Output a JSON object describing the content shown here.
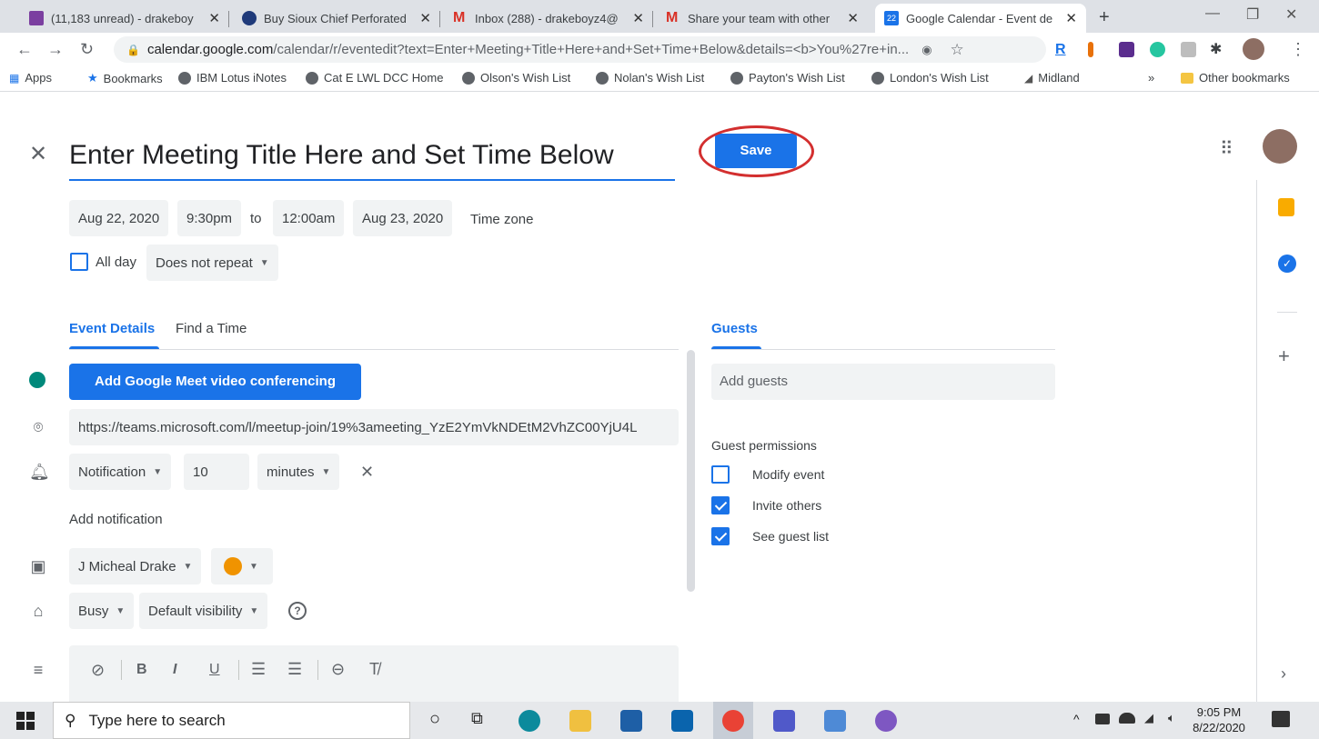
{
  "browser": {
    "tabs": [
      {
        "title": "(11,183 unread) - drakeboy",
        "color": "#7b3fa0"
      },
      {
        "title": "Buy Sioux Chief Perforated",
        "color": "#1f3a7a"
      },
      {
        "title": "Inbox (288) - drakeboyz4@",
        "color": "#d93025"
      },
      {
        "title": "Share your team with other",
        "color": "#d93025"
      },
      {
        "title": "Google Calendar - Event de",
        "color": "#1a73e8",
        "badge": "22"
      }
    ],
    "new_tab": "+",
    "url_host": "calendar.google.com",
    "url_path": "/calendar/r/eventedit?text=Enter+Meeting+Title+Here+and+Set+Time+Below&details=<b>You%27re+in...",
    "bookmarks": [
      "Apps",
      "Bookmarks",
      "IBM Lotus iNotes",
      "Cat E LWL DCC Home",
      "Olson's Wish List",
      "Nolan's Wish List",
      "Payton's Wish List",
      "London's Wish List",
      "Midland"
    ],
    "more_bookmarks": "»",
    "other_bookmarks": "Other bookmarks"
  },
  "event": {
    "title": "Enter Meeting Title Here and Set Time Below",
    "save_label": "Save",
    "start_date": "Aug 22, 2020",
    "start_time": "9:30pm",
    "to": "to",
    "end_time": "12:00am",
    "end_date": "Aug 23, 2020",
    "time_zone": "Time zone",
    "all_day": "All day",
    "repeat": "Does not repeat",
    "tabs": [
      "Event Details",
      "Find a Time"
    ],
    "meet_button": "Add Google Meet video conferencing",
    "location": "https://teams.microsoft.com/l/meetup-join/19%3ameeting_YzE2YmVkNDEtM2VhZC00YjU4L",
    "notification_type": "Notification",
    "notification_value": "10",
    "notification_unit": "minutes",
    "add_notification": "Add notification",
    "calendar_owner": "J Micheal Drake",
    "calendar_color": "#f09300",
    "availability": "Busy",
    "visibility": "Default visibility",
    "help": "?"
  },
  "guests": {
    "heading": "Guests",
    "placeholder": "Add guests",
    "permissions_heading": "Guest permissions",
    "permissions": [
      {
        "label": "Modify event",
        "checked": false
      },
      {
        "label": "Invite others",
        "checked": true
      },
      {
        "label": "See guest list",
        "checked": true
      }
    ]
  },
  "taskbar": {
    "search_placeholder": "Type here to search",
    "time": "9:05 PM",
    "date": "8/22/2020"
  }
}
